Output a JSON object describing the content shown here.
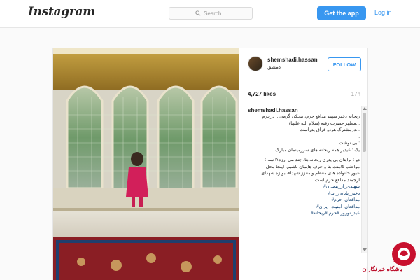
{
  "header": {
    "logo": "Instagram",
    "search_placeholder": "Search",
    "get_app_label": "Get the app",
    "login_label": "Log in"
  },
  "post": {
    "username": "shemshadi.hassan",
    "location": "دمشق",
    "follow_label": "FOLLOW",
    "likes": "4,727 likes",
    "time": "17h",
    "caption_user": "shemshadi.hassan",
    "caption_lines": [
      "ریحانه دختر شهید مدافع حرم، محکی گرمی... درحرم",
      "...مطهر حضرت رقیه (سلام الله علیها)",
      "...درمشترک هردو فراق پدراست",
      ".",
      ": بی نوشت",
      "یک : عیدبر همه ریحانه های سرزمینمان مبارک",
      "دو : برایتان بی پدری ریحانه ها، چند می ارزد؟! سه :",
      "مواظب کامنت ها و حرف هایمان باشیم، اینجا محل",
      "عبور خانواده های معظم و معزز شهداء، بویژه شهدای",
      "ارجمند مدافع حرم است . ."
    ],
    "hashtags": [
      "شهیدی_از_همدان#",
      "دختر_بابایی_اند#",
      "مدافعان_حرم#",
      "مدافعان_امنیت_ایران#",
      "عید_نوروز #حرم #ریحانه#"
    ]
  },
  "watermark": {
    "text": "باشگاه خبرنگاران",
    "color": "#b8001f"
  },
  "colors": {
    "accent": "#3897f0",
    "hashtag": "#003569"
  }
}
